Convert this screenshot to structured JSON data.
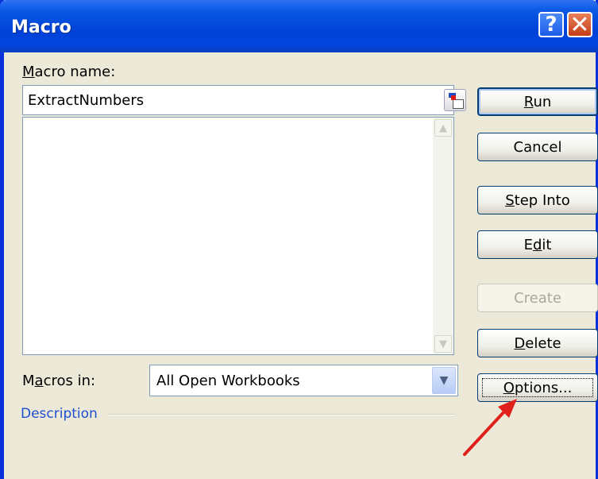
{
  "window": {
    "title": "Macro",
    "help_glyph": "?",
    "close_glyph": "✕"
  },
  "form": {
    "macro_name_mnemonic": "M",
    "macro_name_rest": "acro name:",
    "macro_name_value": "ExtractNumbers",
    "macros_in_pre": "M",
    "macros_in_mnemonic": "a",
    "macros_in_rest": "cros in:",
    "macros_in_value": "All Open Workbooks",
    "description_label": "Description"
  },
  "buttons": {
    "run_mnemonic": "R",
    "run_rest": "un",
    "cancel": "Cancel",
    "step_into_mnemonic": "S",
    "step_into_rest": "tep Into",
    "edit_pre": "E",
    "edit_mnemonic": "d",
    "edit_rest": "it",
    "create": "Create",
    "delete_mnemonic": "D",
    "delete_rest": "elete",
    "options_mnemonic": "O",
    "options_rest": "ptions..."
  },
  "colors": {
    "titlebar": "#0054e3",
    "dialog_bg": "#ece9d8",
    "annotation_arrow": "#e0201a",
    "description_text": "#1f4fd1"
  }
}
